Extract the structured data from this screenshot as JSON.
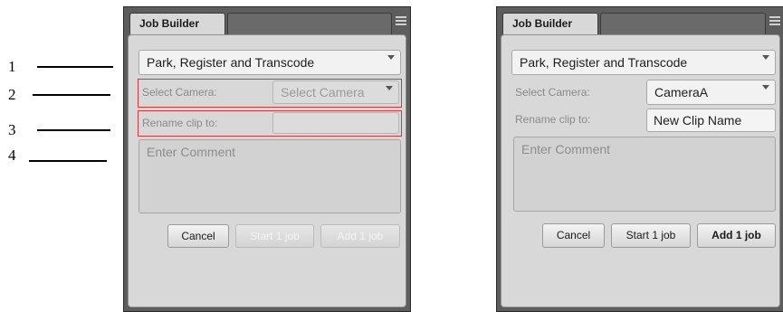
{
  "callouts": [
    "1",
    "2",
    "3",
    "4"
  ],
  "left_panel": {
    "tab_title": "Job Builder",
    "workflow": "Park, Register and Transcode",
    "camera_label": "Select Camera:",
    "camera_value": "Select Camera",
    "rename_label": "Rename clip to:",
    "rename_value": "",
    "comment_placeholder": "Enter Comment",
    "cancel_label": "Cancel",
    "start_label": "Start 1 job",
    "add_label": "Add 1 job"
  },
  "right_panel": {
    "tab_title": "Job Builder",
    "workflow": "Park, Register and Transcode",
    "camera_label": "Select Camera:",
    "camera_value": "CameraA",
    "rename_label": "Rename clip to:",
    "rename_value": "New Clip Name",
    "comment_placeholder": "Enter Comment",
    "cancel_label": "Cancel",
    "start_label": "Start 1 job",
    "add_label": "Add 1 job"
  },
  "colors": {
    "highlight": "#d23a3a",
    "panel_bg": "#d8d8d8",
    "frame": "#5d5d5d"
  }
}
